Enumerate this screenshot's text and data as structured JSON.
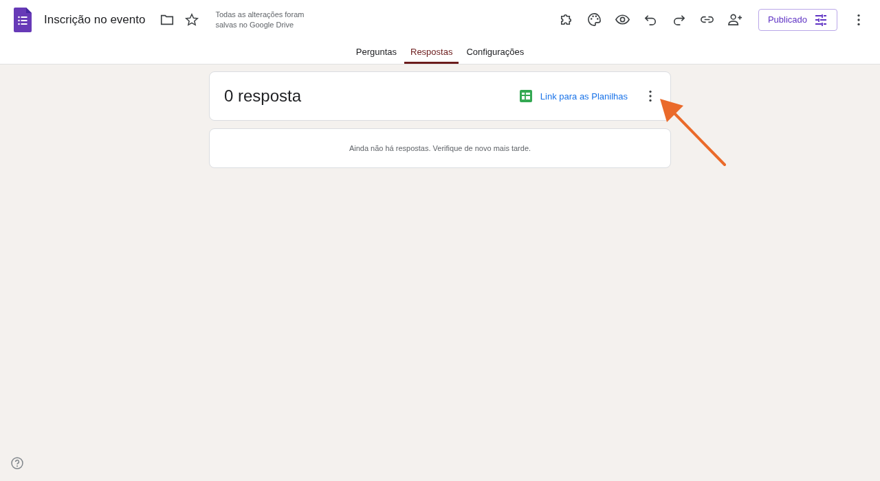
{
  "header": {
    "title": "Inscrição no evento",
    "save_status": "Todas as alterações foram salvas no Google Drive",
    "publish_button": "Publicado"
  },
  "tabs": [
    {
      "label": "Perguntas",
      "selected": false
    },
    {
      "label": "Respostas",
      "selected": true
    },
    {
      "label": "Configurações",
      "selected": false
    }
  ],
  "summary": {
    "count": "0 resposta",
    "sheets_link": "Link para as Planilhas"
  },
  "empty_message": "Ainda não há respostas. Verifique de novo mais tarde."
}
